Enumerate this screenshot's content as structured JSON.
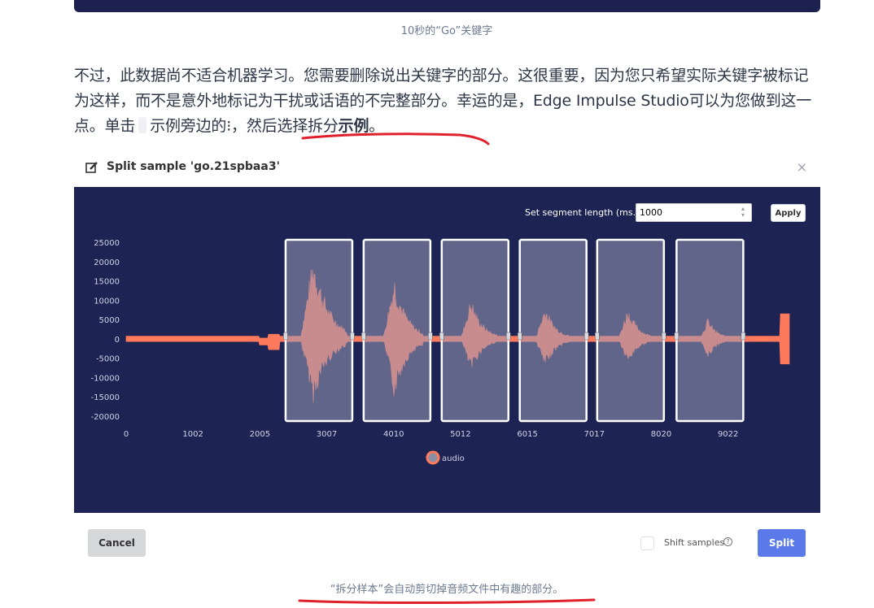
{
  "top_caption": "10秒的“Go”关键字",
  "paragraph": {
    "part1": "不过，此数据尚不适合机器学习。您需要删除说出关键字的部分。这很重要，因为您只希望实际关键字被标记为这样，而不是意外地标记为干扰或话语的不完整部分。幸运的是，Edge Impulse Studio可以为您做到这一点。单击",
    "part2": "示例旁边的⁝，然后选择拆分",
    "bold": "示例",
    "part3": "。"
  },
  "modal": {
    "title": "Split sample 'go.21spbaa3'",
    "close_icon": "close-icon",
    "segment_label": "Set segment length (ms.):",
    "segment_value": "1000",
    "apply_label": "Apply",
    "cancel_label": "Cancel",
    "shift_label": "Shift samples",
    "split_label": "Split"
  },
  "chart_data": {
    "type": "line",
    "y_ticks": [
      "25000",
      "20000",
      "15000",
      "10000",
      "5000",
      "0",
      "-5000",
      "-10000",
      "-15000",
      "-20000"
    ],
    "x_ticks": [
      "0",
      "1002",
      "2005",
      "3007",
      "4010",
      "5012",
      "6015",
      "7017",
      "8020",
      "9022"
    ],
    "ylim": [
      -22000,
      27000
    ],
    "xlim": [
      0,
      10000
    ],
    "legend": [
      "audio"
    ],
    "legend_position": "bottom",
    "series_color": "#ff7a5c",
    "grid": false,
    "segments_ms": [
      [
        2390,
        3390
      ],
      [
        3560,
        4560
      ],
      [
        4730,
        5730
      ],
      [
        5900,
        6900
      ],
      [
        7060,
        8060
      ],
      [
        8250,
        9250
      ]
    ],
    "bursts": [
      {
        "center_ms": 2810,
        "amp_pos": 23000,
        "amp_neg": 17000,
        "duration_ms": 500
      },
      {
        "center_ms": 4020,
        "amp_pos": 17000,
        "amp_neg": 16000,
        "duration_ms": 420
      },
      {
        "center_ms": 5170,
        "amp_pos": 11000,
        "amp_neg": 9000,
        "duration_ms": 380
      },
      {
        "center_ms": 6280,
        "amp_pos": 9000,
        "amp_neg": 8000,
        "duration_ms": 360
      },
      {
        "center_ms": 7520,
        "amp_pos": 8500,
        "amp_neg": 7000,
        "duration_ms": 350
      },
      {
        "center_ms": 8720,
        "amp_pos": 5500,
        "amp_neg": 5500,
        "duration_ms": 300
      }
    ]
  },
  "bottom_caption": "“拆分样本”会自动剪切掉音频文件中有趣的部分。",
  "colors": {
    "plot_bg": "#1d2453",
    "segment_fill": "#9a9ab8",
    "split_button": "#5b79e8",
    "annotation": "#e0202a"
  }
}
